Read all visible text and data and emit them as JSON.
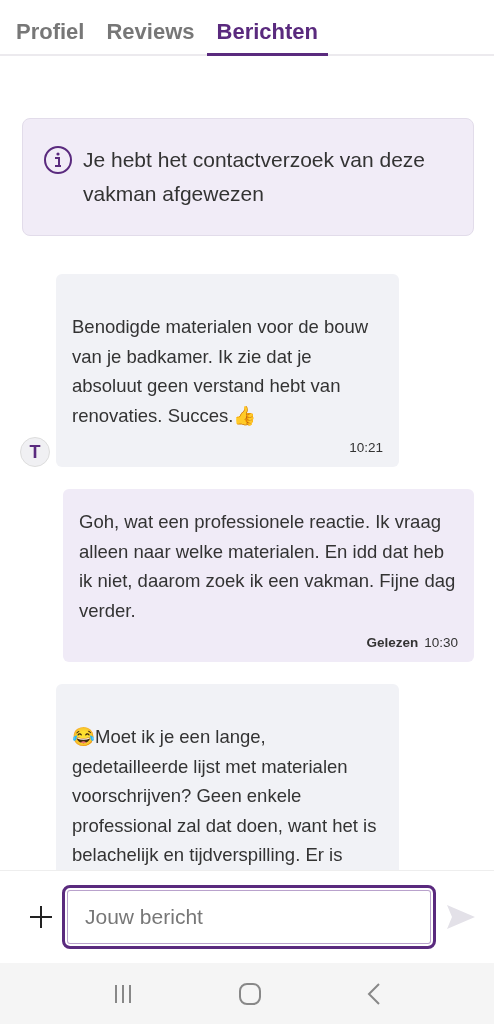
{
  "tabs": [
    {
      "label": "Profiel",
      "selected": false
    },
    {
      "label": "Reviews",
      "selected": false
    },
    {
      "label": "Berichten",
      "selected": true
    }
  ],
  "notice": {
    "text": "Je hebt het contactverzoek van deze vakman afgewezen"
  },
  "messages": [
    {
      "kind": "received",
      "text": "Benodigde materialen voor de bouw van je badkamer. Ik zie dat je absoluut geen verstand hebt van renovaties. Succes.👍",
      "time": "10:21",
      "avatar": "T"
    },
    {
      "kind": "sent",
      "text": "Goh, wat een professionele reactie. Ik vraag alleen naar welke materialen. En idd dat heb ik niet, daarom zoek ik een vakman. Fijne dag verder.",
      "status": "Gelezen",
      "time": "10:30"
    },
    {
      "kind": "received",
      "text": "😂Moet ik je een lange, gedetailleerde lijst met materialen voorschrijven? Geen enkele professional zal dat doen, want het is belachelijk en tijdverspilling. Er is"
    }
  ],
  "composer": {
    "placeholder": "Jouw bericht",
    "send_disabled": true
  }
}
